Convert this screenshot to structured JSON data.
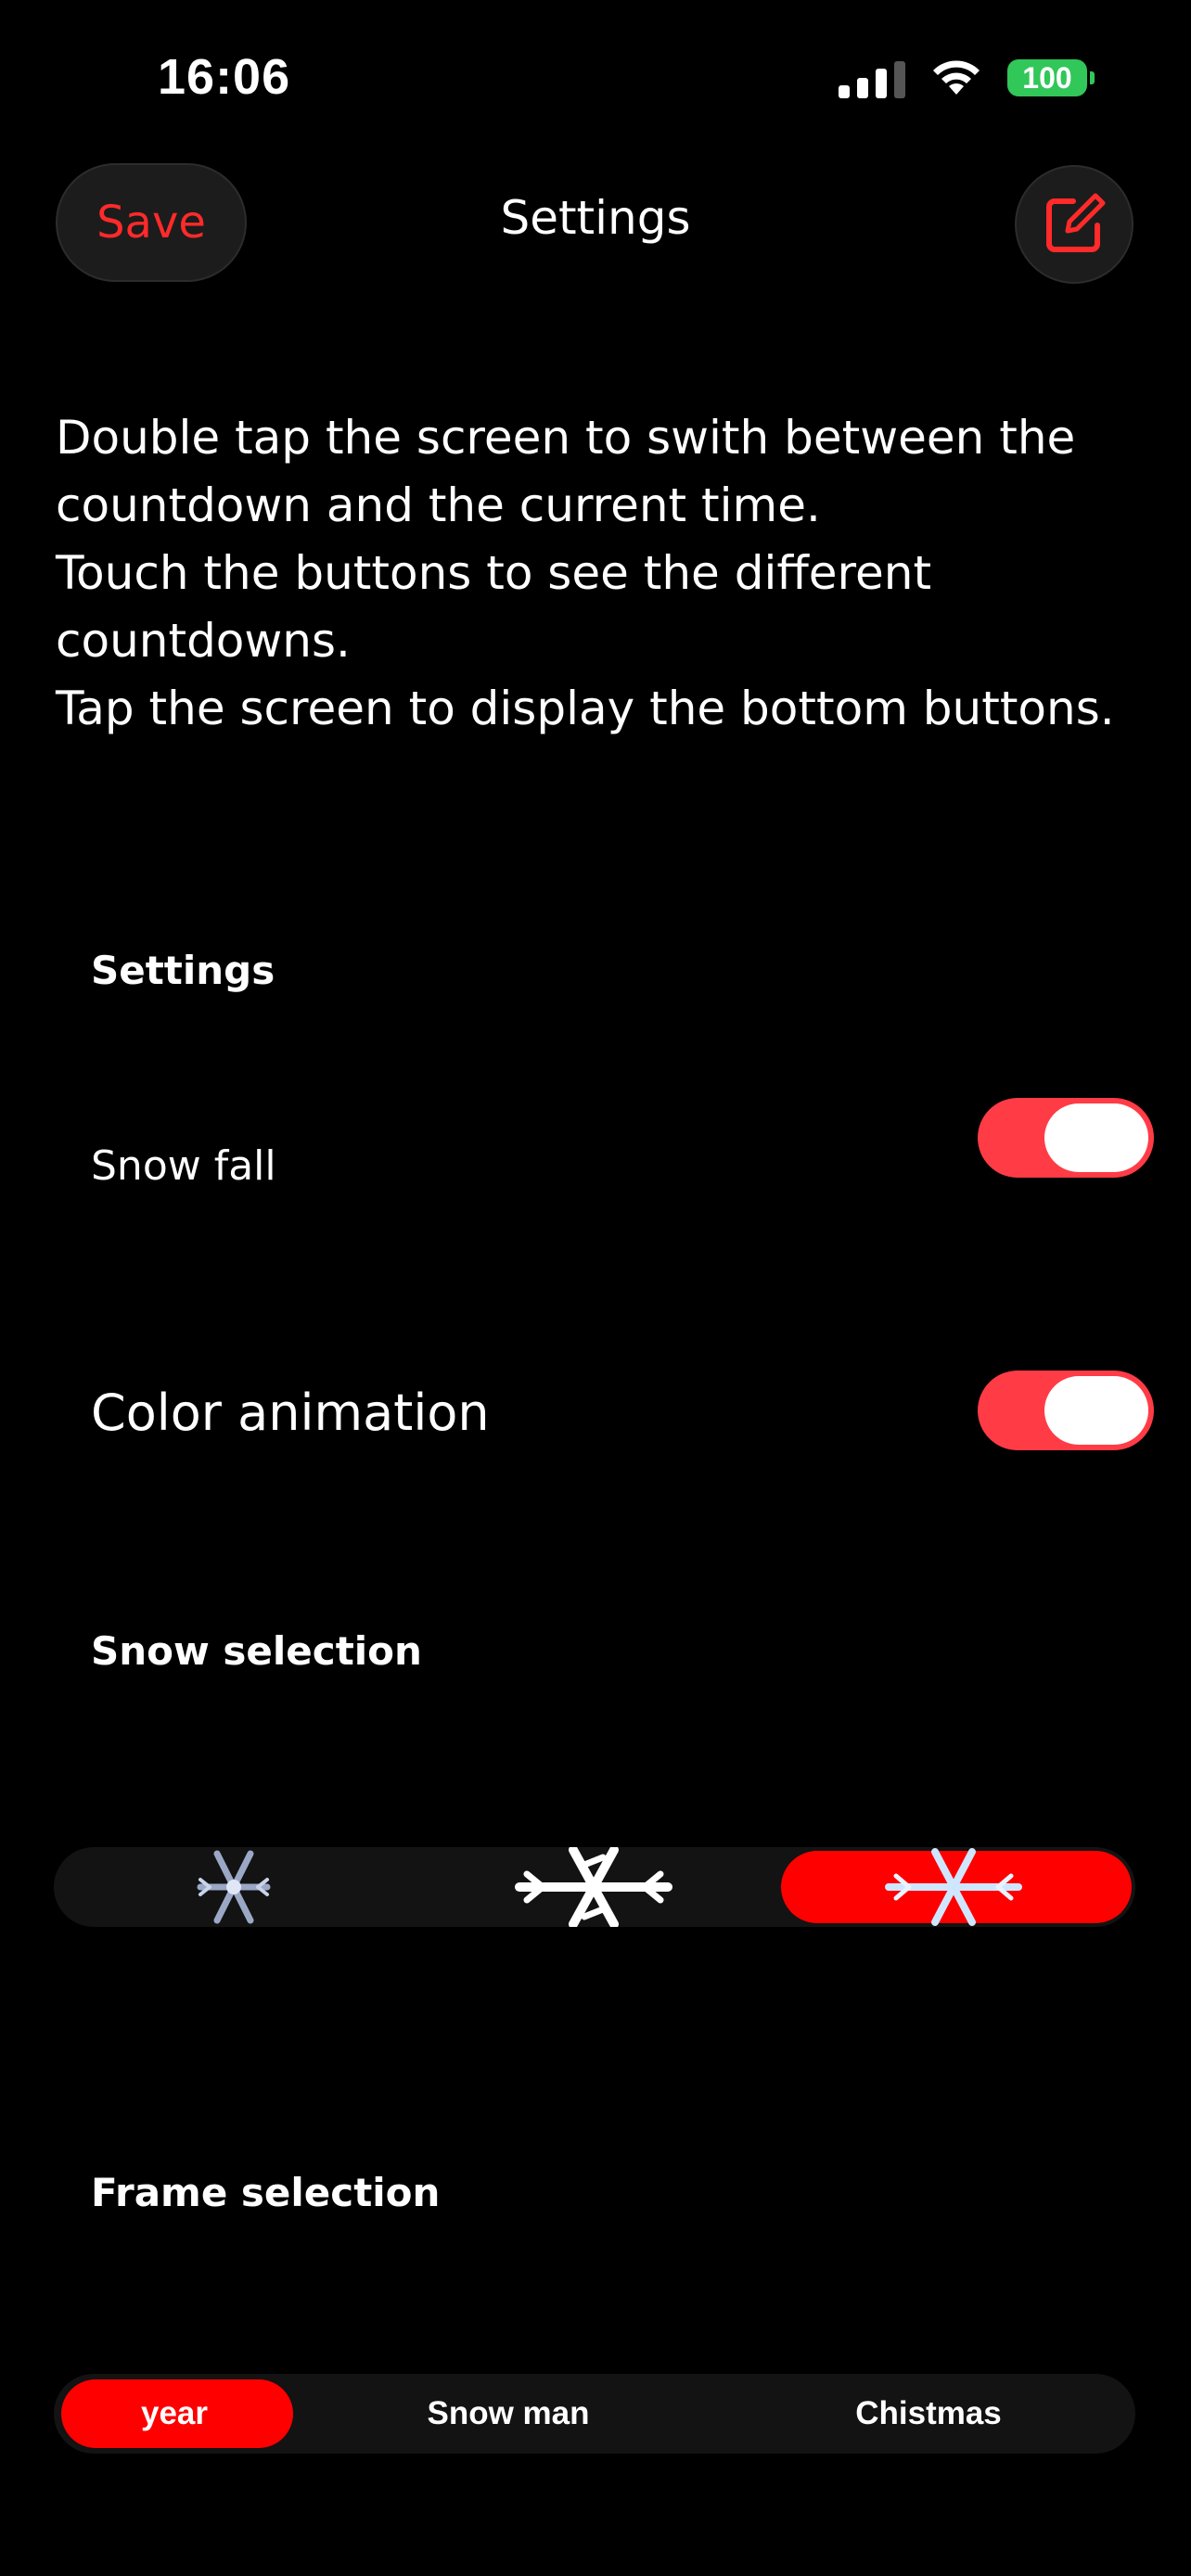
{
  "status_bar": {
    "time": "16:06",
    "battery_level": "100",
    "battery_color": "#31c759",
    "icons": [
      "signal-icon",
      "wifi-icon",
      "battery-icon"
    ]
  },
  "nav": {
    "save_label": "Save",
    "title": "Settings",
    "edit_icon": "square-pencil-icon",
    "accent_color": "#ff2a2a"
  },
  "instructions": [
    "Double tap the screen to swith between the countdown and the current time.",
    "Touch the buttons to see the different countdowns.",
    "Tap the screen to display the bottom buttons."
  ],
  "settings_section": {
    "header": "Settings",
    "toggles": [
      {
        "label": "Snow fall",
        "on": true
      },
      {
        "label": "Color animation",
        "on": true
      }
    ],
    "toggle_on_color": "#ff3b46"
  },
  "snow_selection": {
    "header": "Snow selection",
    "options": [
      {
        "icon": "snowflake-icon-shaded",
        "selected": false
      },
      {
        "icon": "snowflake-icon-white",
        "selected": false
      },
      {
        "icon": "snowflake-icon-blue",
        "selected": true
      }
    ],
    "selected_color": "#ff0000"
  },
  "frame_selection": {
    "header": "Frame selection",
    "options": [
      {
        "label": "year",
        "selected": true
      },
      {
        "label": "Snow man",
        "selected": false
      },
      {
        "label": "Chistmas",
        "selected": false
      }
    ],
    "selected_color": "#ff0000"
  }
}
